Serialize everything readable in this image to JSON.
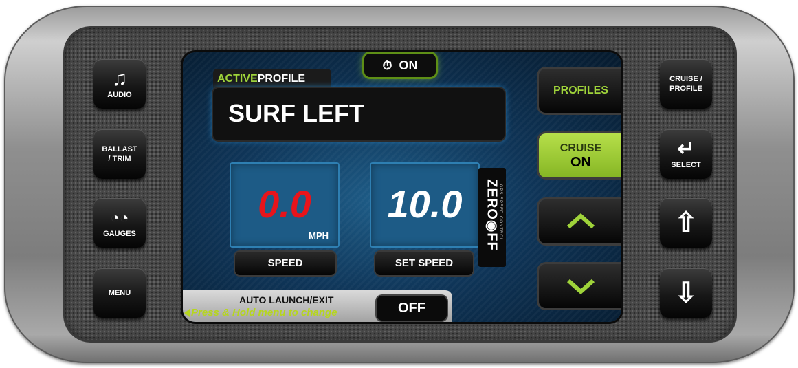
{
  "left_buttons": [
    {
      "label": "AUDIO",
      "icon": "music-note-icon",
      "glyph": "♫"
    },
    {
      "label": "BALLAST\n/ TRIM"
    },
    {
      "label": "GAUGES",
      "icon": "gauges-icon",
      "glyph": "◔◔"
    },
    {
      "label": "MENU"
    }
  ],
  "right_buttons": [
    {
      "label": "CRUISE /\nPROFILE"
    },
    {
      "label": "SELECT",
      "icon": "enter-arrow-icon",
      "glyph": "↵"
    },
    {
      "icon": "arrow-up-icon",
      "glyph": "⇧"
    },
    {
      "icon": "arrow-down-icon",
      "glyph": "⇩"
    }
  ],
  "screen": {
    "cruise_indicator": {
      "icon": "speedometer-icon",
      "glyph": "⏱",
      "label": "ON"
    },
    "profile": {
      "tab_active": "ACTIVE",
      "tab_profile": "PROFILE",
      "name": "SURF LEFT"
    },
    "speed": {
      "value": "0.0",
      "unit": "MPH",
      "label": "SPEED",
      "color": "#e8141b"
    },
    "set_speed": {
      "value": "10.0",
      "label": "SET SPEED",
      "color": "#ffffff"
    },
    "brand": {
      "name": "ZERO◉FF",
      "tagline": "GPS SPEED CONTROL"
    },
    "side_buttons": {
      "profiles": "PROFILES",
      "cruise_line1": "CRUISE",
      "cruise_line2": "ON",
      "up": "^",
      "down": "v"
    },
    "auto_launch": {
      "title": "AUTO LAUNCH/EXIT",
      "hint": "Press & Hold menu to change",
      "value": "OFF"
    }
  },
  "colors": {
    "accent_green": "#9fd33a",
    "speed_red": "#e8141b",
    "screen_blue": "#1d5b86"
  }
}
